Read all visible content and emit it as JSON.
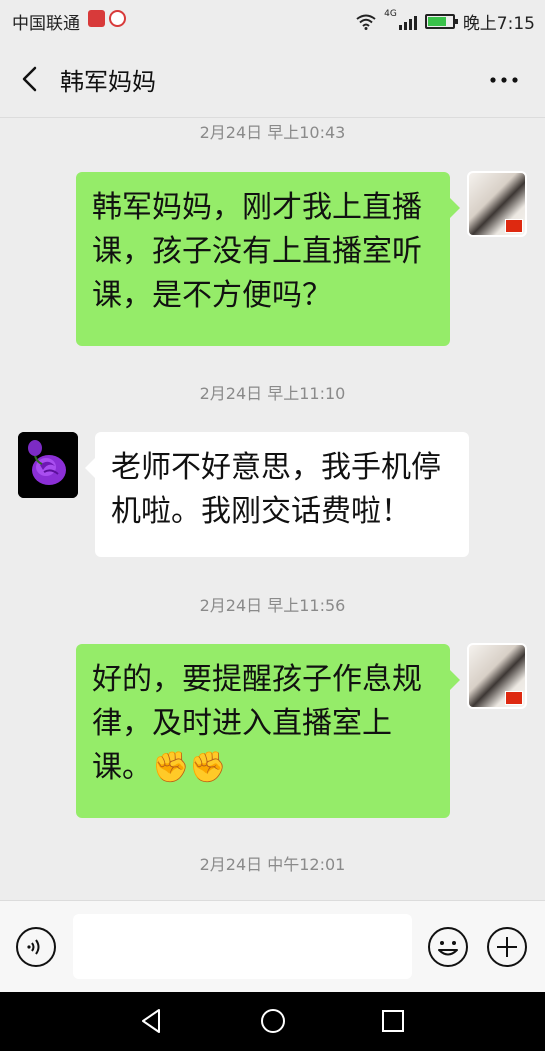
{
  "status_bar": {
    "carrier": "中国联通",
    "network": "4G",
    "time": "晚上7:15"
  },
  "header": {
    "title": "韩军妈妈",
    "more_label": "•••"
  },
  "messages": [
    {
      "time": "2月24日 早上10:43",
      "sender": "me",
      "text": "韩军妈妈，刚才我上直播课，孩子没有上直播室听课，是不方便吗？",
      "lines": [
        "韩军妈妈，刚才我上直播",
        "课，孩子没有上直播室听",
        "课，是不方便吗？"
      ]
    },
    {
      "time": "2月24日 早上11:10",
      "sender": "other",
      "text": "老师不好意思，我手机停机啦。我刚交话费啦！",
      "lines": [
        "老师不好意思，我手机停",
        "机啦。我刚交话费啦！"
      ]
    },
    {
      "time": "2月24日 早上11:56",
      "sender": "me",
      "text": "好的，要提醒孩子作息规律，及时进入直播室上课。✊✊",
      "lines": [
        "好的，要提醒孩子作息规",
        "律，及时进入直播室上",
        "课。"
      ],
      "emoji": "✊✊"
    },
    {
      "time": "2月24日 中午12:01"
    }
  ],
  "icons": {
    "back": "chevron-left-icon",
    "more": "more-horizontal-icon",
    "voice": "voice-icon",
    "emoji": "smiley-icon",
    "plus": "plus-circle-icon"
  },
  "colors": {
    "my_bubble": "#95ec69",
    "other_bubble": "#ffffff",
    "background": "#ededed"
  }
}
